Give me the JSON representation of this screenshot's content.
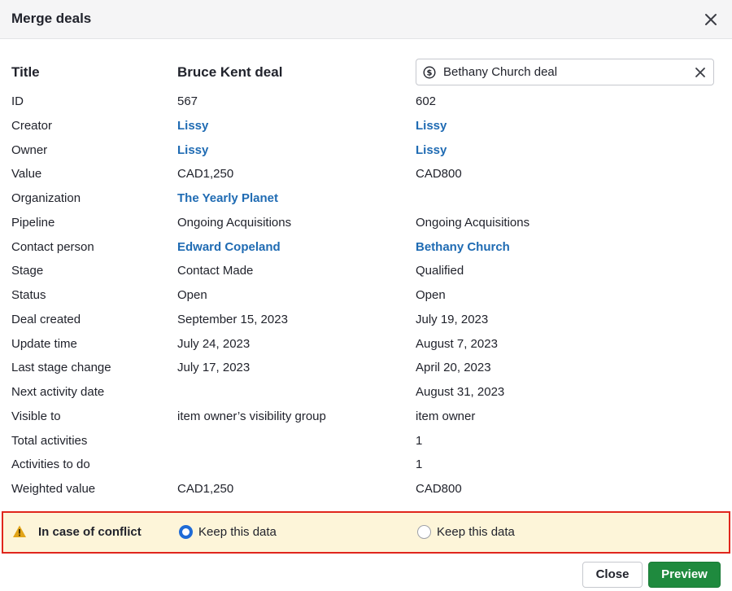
{
  "dialog": {
    "title": "Merge deals"
  },
  "columns": {
    "field_header": "Title",
    "left_deal_title": "Bruce Kent deal",
    "right_deal_title": "Bethany Church deal"
  },
  "rows": [
    {
      "label": "ID",
      "left": "567",
      "right": "602",
      "left_link": false,
      "right_link": false
    },
    {
      "label": "Creator",
      "left": "Lissy",
      "right": "Lissy",
      "left_link": true,
      "right_link": true
    },
    {
      "label": "Owner",
      "left": "Lissy",
      "right": "Lissy",
      "left_link": true,
      "right_link": true
    },
    {
      "label": "Value",
      "left": "CAD1,250",
      "right": "CAD800",
      "left_link": false,
      "right_link": false
    },
    {
      "label": "Organization",
      "left": "The Yearly Planet",
      "right": "",
      "left_link": true,
      "right_link": false
    },
    {
      "label": "Pipeline",
      "left": "Ongoing Acquisitions",
      "right": "Ongoing Acquisitions",
      "left_link": false,
      "right_link": false
    },
    {
      "label": "Contact person",
      "left": "Edward Copeland",
      "right": "Bethany Church",
      "left_link": true,
      "right_link": true
    },
    {
      "label": "Stage",
      "left": "Contact Made",
      "right": "Qualified",
      "left_link": false,
      "right_link": false
    },
    {
      "label": "Status",
      "left": "Open",
      "right": "Open",
      "left_link": false,
      "right_link": false
    },
    {
      "label": "Deal created",
      "left": "September 15, 2023",
      "right": "July 19, 2023",
      "left_link": false,
      "right_link": false
    },
    {
      "label": "Update time",
      "left": "July 24, 2023",
      "right": "August 7, 2023",
      "left_link": false,
      "right_link": false
    },
    {
      "label": "Last stage change",
      "left": "July 17, 2023",
      "right": "April 20, 2023",
      "left_link": false,
      "right_link": false
    },
    {
      "label": "Next activity date",
      "left": "",
      "right": "August 31, 2023",
      "left_link": false,
      "right_link": false
    },
    {
      "label": "Visible to",
      "left": "item owner’s visibility group",
      "right": "item owner",
      "left_link": false,
      "right_link": false
    },
    {
      "label": "Total activities",
      "left": "",
      "right": "1",
      "left_link": false,
      "right_link": false
    },
    {
      "label": "Activities to do",
      "left": "",
      "right": "1",
      "left_link": false,
      "right_link": false
    },
    {
      "label": "Weighted value",
      "left": "CAD1,250",
      "right": "CAD800",
      "left_link": false,
      "right_link": false
    }
  ],
  "conflict": {
    "label": "In case of conflict",
    "left_option": "Keep this data",
    "right_option": "Keep this data",
    "selected": "left"
  },
  "footer": {
    "close_label": "Close",
    "preview_label": "Preview"
  },
  "icons": {
    "close": "close-icon",
    "deal": "dollar-circle-icon",
    "clear": "clear-icon",
    "warning": "warning-icon"
  },
  "colors": {
    "link": "#1f6bb3",
    "primary": "#1f8a3e",
    "radio_selected": "#1f6bd6",
    "conflict_bg": "#fdf5d9",
    "conflict_border": "#e0261d",
    "warning": "#e2a417"
  }
}
